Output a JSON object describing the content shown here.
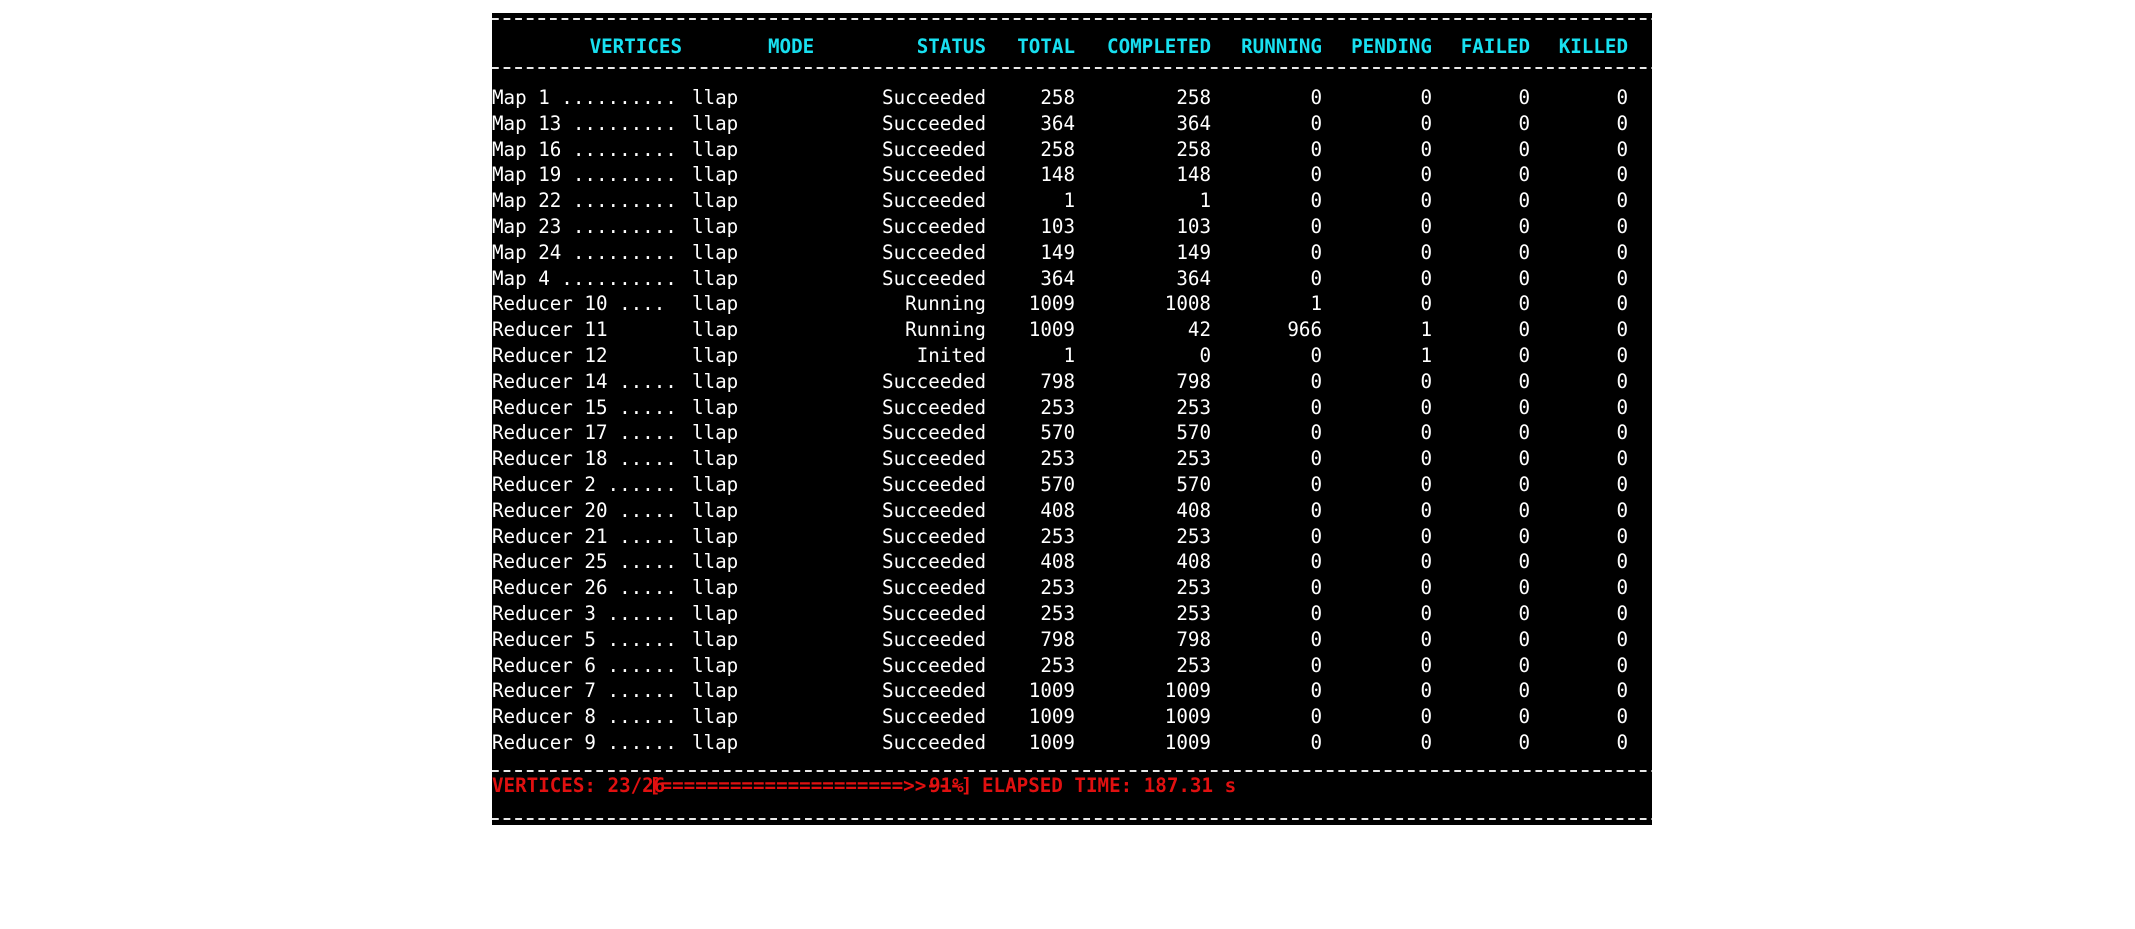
{
  "headers": {
    "vertices": "VERTICES",
    "mode": "MODE",
    "status": "STATUS",
    "total": "TOTAL",
    "completed": "COMPLETED",
    "running": "RUNNING",
    "pending": "PENDING",
    "failed": "FAILED",
    "killed": "KILLED"
  },
  "rows": [
    {
      "vertex": "Map 1 ..........",
      "mode": "llap",
      "status": "Succeeded",
      "total": "258",
      "completed": "258",
      "running": "0",
      "pending": "0",
      "failed": "0",
      "killed": "0"
    },
    {
      "vertex": "Map 13 .........",
      "mode": "llap",
      "status": "Succeeded",
      "total": "364",
      "completed": "364",
      "running": "0",
      "pending": "0",
      "failed": "0",
      "killed": "0"
    },
    {
      "vertex": "Map 16 .........",
      "mode": "llap",
      "status": "Succeeded",
      "total": "258",
      "completed": "258",
      "running": "0",
      "pending": "0",
      "failed": "0",
      "killed": "0"
    },
    {
      "vertex": "Map 19 .........",
      "mode": "llap",
      "status": "Succeeded",
      "total": "148",
      "completed": "148",
      "running": "0",
      "pending": "0",
      "failed": "0",
      "killed": "0"
    },
    {
      "vertex": "Map 22 .........",
      "mode": "llap",
      "status": "Succeeded",
      "total": "1",
      "completed": "1",
      "running": "0",
      "pending": "0",
      "failed": "0",
      "killed": "0"
    },
    {
      "vertex": "Map 23 .........",
      "mode": "llap",
      "status": "Succeeded",
      "total": "103",
      "completed": "103",
      "running": "0",
      "pending": "0",
      "failed": "0",
      "killed": "0"
    },
    {
      "vertex": "Map 24 .........",
      "mode": "llap",
      "status": "Succeeded",
      "total": "149",
      "completed": "149",
      "running": "0",
      "pending": "0",
      "failed": "0",
      "killed": "0"
    },
    {
      "vertex": "Map 4 ..........",
      "mode": "llap",
      "status": "Succeeded",
      "total": "364",
      "completed": "364",
      "running": "0",
      "pending": "0",
      "failed": "0",
      "killed": "0"
    },
    {
      "vertex": "Reducer 10 ....",
      "mode": "llap",
      "status": "Running",
      "total": "1009",
      "completed": "1008",
      "running": "1",
      "pending": "0",
      "failed": "0",
      "killed": "0"
    },
    {
      "vertex": "Reducer 11",
      "mode": "llap",
      "status": "Running",
      "total": "1009",
      "completed": "42",
      "running": "966",
      "pending": "1",
      "failed": "0",
      "killed": "0"
    },
    {
      "vertex": "Reducer 12",
      "mode": "llap",
      "status": "Inited",
      "total": "1",
      "completed": "0",
      "running": "0",
      "pending": "1",
      "failed": "0",
      "killed": "0"
    },
    {
      "vertex": "Reducer 14 .....",
      "mode": "llap",
      "status": "Succeeded",
      "total": "798",
      "completed": "798",
      "running": "0",
      "pending": "0",
      "failed": "0",
      "killed": "0"
    },
    {
      "vertex": "Reducer 15 .....",
      "mode": "llap",
      "status": "Succeeded",
      "total": "253",
      "completed": "253",
      "running": "0",
      "pending": "0",
      "failed": "0",
      "killed": "0"
    },
    {
      "vertex": "Reducer 17 .....",
      "mode": "llap",
      "status": "Succeeded",
      "total": "570",
      "completed": "570",
      "running": "0",
      "pending": "0",
      "failed": "0",
      "killed": "0"
    },
    {
      "vertex": "Reducer 18 .....",
      "mode": "llap",
      "status": "Succeeded",
      "total": "253",
      "completed": "253",
      "running": "0",
      "pending": "0",
      "failed": "0",
      "killed": "0"
    },
    {
      "vertex": "Reducer 2 ......",
      "mode": "llap",
      "status": "Succeeded",
      "total": "570",
      "completed": "570",
      "running": "0",
      "pending": "0",
      "failed": "0",
      "killed": "0"
    },
    {
      "vertex": "Reducer 20 .....",
      "mode": "llap",
      "status": "Succeeded",
      "total": "408",
      "completed": "408",
      "running": "0",
      "pending": "0",
      "failed": "0",
      "killed": "0"
    },
    {
      "vertex": "Reducer 21 .....",
      "mode": "llap",
      "status": "Succeeded",
      "total": "253",
      "completed": "253",
      "running": "0",
      "pending": "0",
      "failed": "0",
      "killed": "0"
    },
    {
      "vertex": "Reducer 25 .....",
      "mode": "llap",
      "status": "Succeeded",
      "total": "408",
      "completed": "408",
      "running": "0",
      "pending": "0",
      "failed": "0",
      "killed": "0"
    },
    {
      "vertex": "Reducer 26 .....",
      "mode": "llap",
      "status": "Succeeded",
      "total": "253",
      "completed": "253",
      "running": "0",
      "pending": "0",
      "failed": "0",
      "killed": "0"
    },
    {
      "vertex": "Reducer 3 ......",
      "mode": "llap",
      "status": "Succeeded",
      "total": "253",
      "completed": "253",
      "running": "0",
      "pending": "0",
      "failed": "0",
      "killed": "0"
    },
    {
      "vertex": "Reducer 5 ......",
      "mode": "llap",
      "status": "Succeeded",
      "total": "798",
      "completed": "798",
      "running": "0",
      "pending": "0",
      "failed": "0",
      "killed": "0"
    },
    {
      "vertex": "Reducer 6 ......",
      "mode": "llap",
      "status": "Succeeded",
      "total": "253",
      "completed": "253",
      "running": "0",
      "pending": "0",
      "failed": "0",
      "killed": "0"
    },
    {
      "vertex": "Reducer 7 ......",
      "mode": "llap",
      "status": "Succeeded",
      "total": "1009",
      "completed": "1009",
      "running": "0",
      "pending": "0",
      "failed": "0",
      "killed": "0"
    },
    {
      "vertex": "Reducer 8 ......",
      "mode": "llap",
      "status": "Succeeded",
      "total": "1009",
      "completed": "1009",
      "running": "0",
      "pending": "0",
      "failed": "0",
      "killed": "0"
    },
    {
      "vertex": "Reducer 9 ......",
      "mode": "llap",
      "status": "Succeeded",
      "total": "1009",
      "completed": "1009",
      "running": "0",
      "pending": "0",
      "failed": "0",
      "killed": "0"
    }
  ],
  "footer": {
    "vertices": "VERTICES: 23/26",
    "progress_bar": "[=====================>>---]",
    "progress_percent": "91%",
    "progress_fraction": 0.91,
    "elapsed": "ELAPSED TIME: 187.31 s"
  },
  "colors": {
    "background": "#000000",
    "header_text": "#18e0f0",
    "body_text": "#ffffff",
    "footer_text": "#e01010"
  }
}
